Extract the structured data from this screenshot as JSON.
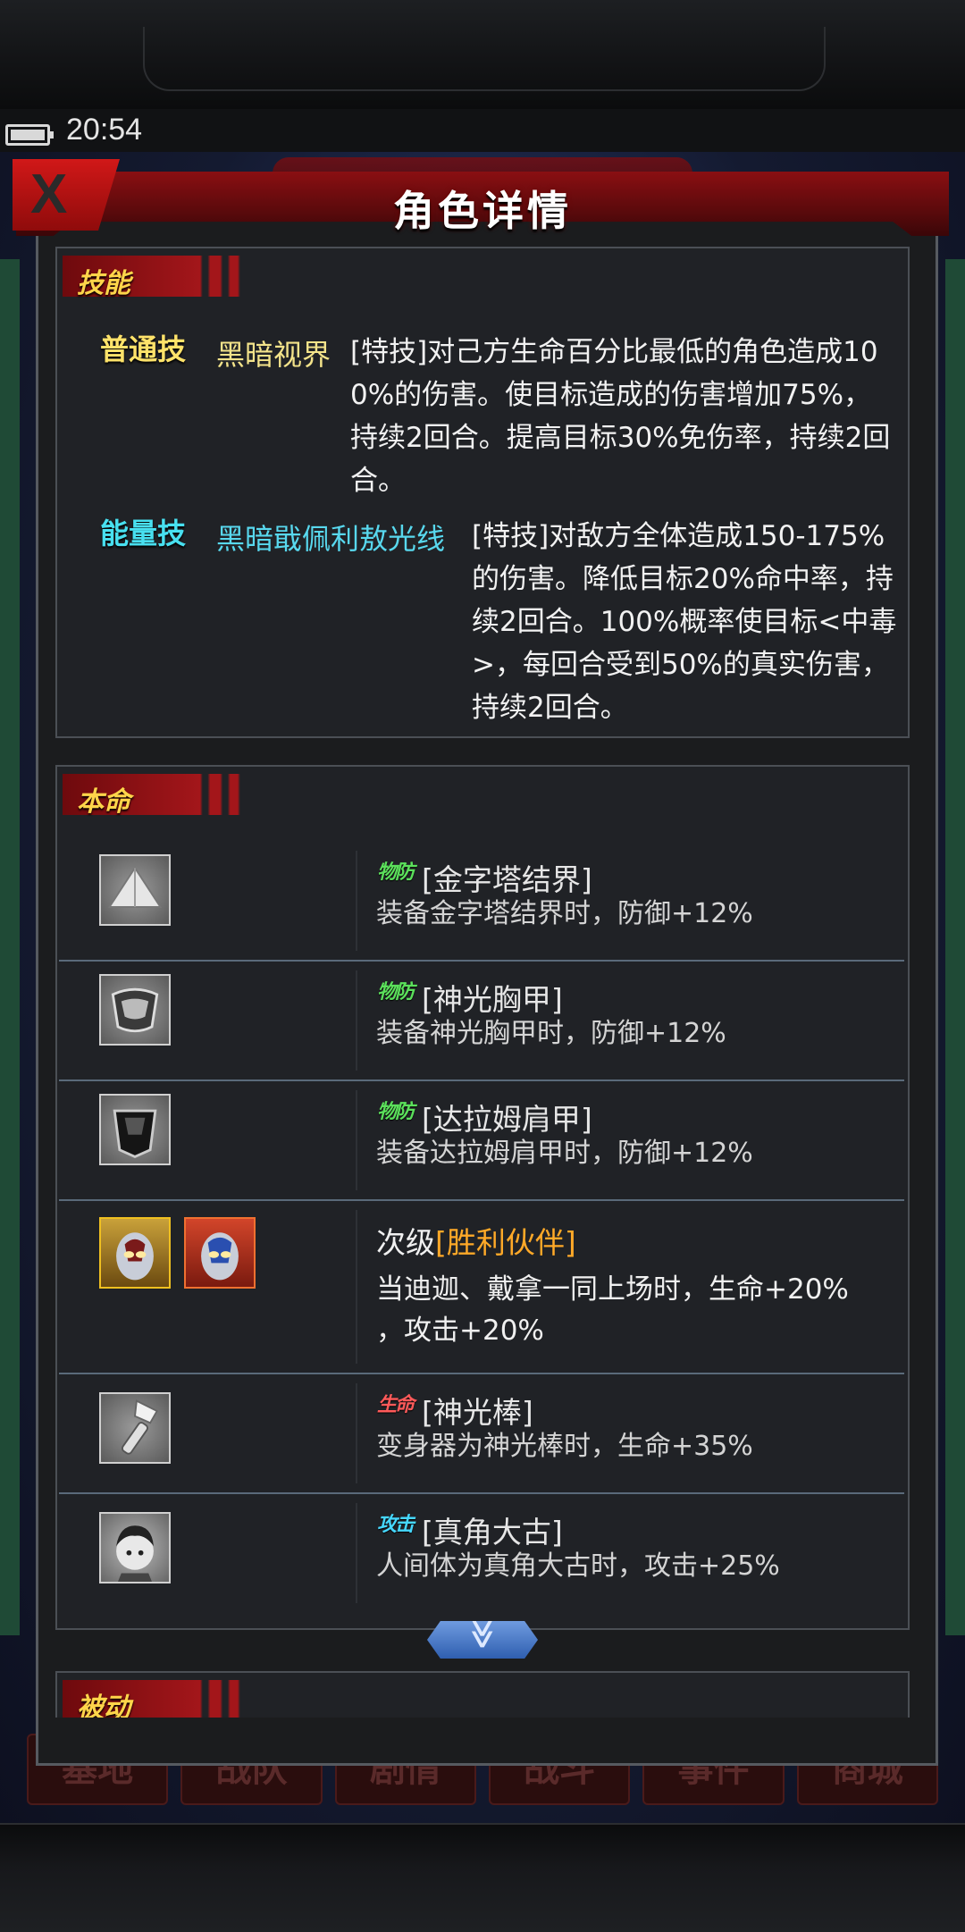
{
  "status_bar": {
    "time": "20:54"
  },
  "background": {
    "nav_buttons": [
      "基地",
      "战队",
      "剧情",
      "战斗",
      "事件",
      "商城"
    ]
  },
  "dialog": {
    "title": "角色详情",
    "close_label": "X"
  },
  "skills": {
    "section_label": "技能",
    "items": [
      {
        "type_label": "普通技",
        "name": "黑暗视界",
        "desc": "[特技]对己方生命百分比最低的角色造成100%的伤害。使目标造成的伤害增加75%，持续2回合。提高目标30%免伤率，持续2回合。",
        "type_color": "#ffe36a",
        "name_color": "#f3e38a"
      },
      {
        "type_label": "能量技",
        "name": "黑暗戢佩利敖光线",
        "desc": "[特技]对敌方全体造成150-175%的伤害。降低目标20%命中率，持续2回合。100%概率使目标<中毒>，每回合受到50%的真实伤害，持续2回合。",
        "type_color": "#48e0f0",
        "name_color": "#58d8ee"
      }
    ]
  },
  "fate": {
    "section_label": "本命",
    "rows": [
      {
        "icon": "pyramid-icon",
        "badge": "物防",
        "badge_color": "#5be05b",
        "title": "[金字塔结界]",
        "desc": "装备金字塔结界时，防御+12%"
      },
      {
        "icon": "chest-armor-icon",
        "badge": "物防",
        "badge_color": "#5be05b",
        "title": "[神光胸甲]",
        "desc": "装备神光胸甲时，防御+12%"
      },
      {
        "icon": "shoulder-armor-icon",
        "badge": "物防",
        "badge_color": "#5be05b",
        "title": "[达拉姆肩甲]",
        "desc": "装备达拉姆肩甲时，防御+12%"
      },
      {
        "icons": [
          "tiga-portrait-icon",
          "dyna-portrait-icon"
        ],
        "prefix": "次级",
        "title": "[胜利伙伴]",
        "title_color": "#ffa928",
        "desc_line1": "当迪迦、戴拿一同上场时，生命+20%",
        "desc_line2": "，攻击+20%"
      },
      {
        "icon": "sparklence-icon",
        "badge": "生命",
        "badge_color": "#ff5a5a",
        "title": "[神光棒]",
        "desc": "变身器为神光棒时，生命+35%"
      },
      {
        "icon": "daigo-portrait-icon",
        "badge": "攻击",
        "badge_color": "#46d8ff",
        "title": "[真角大古]",
        "desc": "人间体为真角大古时，攻击+25%"
      }
    ],
    "scroll_label": "≫"
  },
  "passive": {
    "section_label": "被动"
  }
}
